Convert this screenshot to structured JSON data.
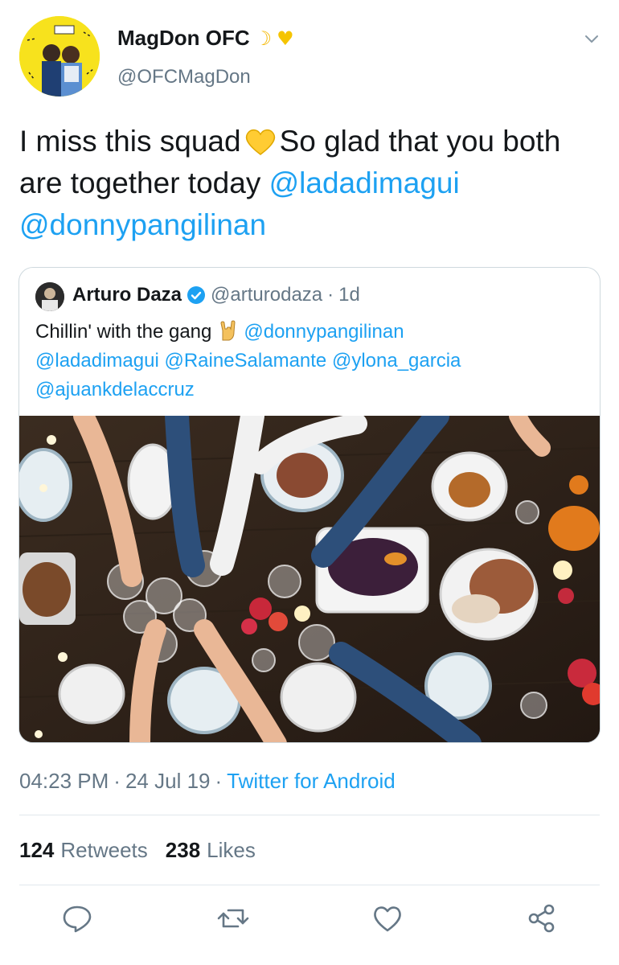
{
  "tweet": {
    "display_name": "MagDon OFC",
    "name_emojis": {
      "moon": "☽",
      "heart": "♥"
    },
    "handle": "@OFCMagDon",
    "text_part1": "I miss this squad",
    "text_part2": "So glad that you both are together today",
    "mention1": "@ladadimagui",
    "mention2": "@donnypangilinan",
    "time": "04:23 PM",
    "sep": "·",
    "date": "24 Jul 19",
    "source": "Twitter for Android",
    "retweet_count": "124",
    "retweet_label": "Retweets",
    "like_count": "238",
    "like_label": "Likes"
  },
  "quote": {
    "name": "Arturo Daza",
    "handle": "@arturodaza",
    "sep": "·",
    "age": "1d",
    "text_start": "Chillin' with the gang",
    "mention_donny": "@donnypangilinan",
    "mention_lada": "@ladadimagui",
    "mention_raine": "@RaineSalamante",
    "mention_ylona": "@ylona_garcia",
    "mention_ajuan": "@ajuankdelaccruz"
  },
  "icons": {
    "caret": "chevron-down-icon",
    "reply": "reply-icon",
    "retweet": "retweet-icon",
    "like": "heart-icon",
    "share": "share-icon",
    "verified": "verified-badge-icon"
  },
  "colors": {
    "link": "#1da1f2",
    "secondary": "#657786",
    "text": "#14171a",
    "avatar_bg": "#f7e21d"
  }
}
